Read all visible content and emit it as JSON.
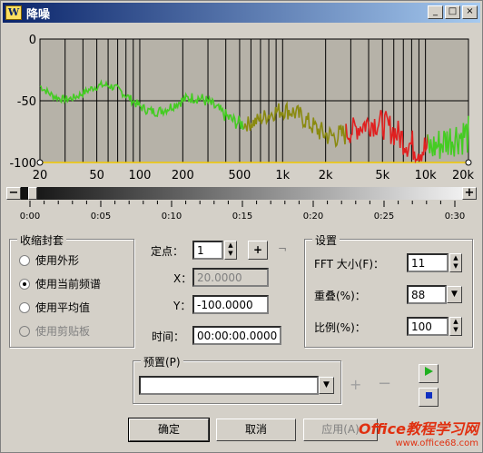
{
  "window": {
    "title": "降噪",
    "app_icon": "W"
  },
  "titlebar_buttons": {
    "minimize": "_",
    "maximize": "□",
    "close": "×"
  },
  "graph": {
    "y_ticks": [
      "0",
      "-50",
      "-100"
    ],
    "x_ticks": [
      "20",
      "50",
      "100",
      "200",
      "500",
      "1k",
      "2k",
      "5k",
      "10k",
      "20k"
    ],
    "colors": {
      "plot_bg": "#b6b2a8",
      "grid": "#000000",
      "low": "#44cc22",
      "high": "#e02020",
      "mid": "#8a8a10",
      "threshold": "#f0c800"
    }
  },
  "scroll": {
    "minus": "−",
    "plus": "+"
  },
  "ruler": {
    "labels": [
      "0:00",
      "0:05",
      "0:10",
      "0:15",
      "0:20",
      "0:25",
      "0:30"
    ]
  },
  "envelope": {
    "title": "收缩封套",
    "options": [
      {
        "label": "使用外形",
        "selected": false,
        "disabled": false
      },
      {
        "label": "使用当前频谱",
        "selected": true,
        "disabled": false
      },
      {
        "label": "使用平均值",
        "selected": false,
        "disabled": false
      },
      {
        "label": "使用剪贴板",
        "selected": false,
        "disabled": true
      }
    ]
  },
  "point": {
    "fixed_label": "定点：",
    "fixed_value": "1",
    "add_button": "+",
    "x_label": "X：",
    "x_value": "20.0000",
    "y_label": "Y：",
    "y_value": "-100.0000",
    "time_label": "时间：",
    "time_value": "00:00:00.0000"
  },
  "settings": {
    "title": "设置",
    "fft_label": "FFT 大小(F)：",
    "fft_value": "11",
    "overlap_label": "重叠(%)：",
    "overlap_value": "88",
    "ratio_label": "比例(%)：",
    "ratio_value": "100"
  },
  "preset": {
    "title": "预置(P)",
    "value": "",
    "add": "+",
    "remove": "−"
  },
  "buttons": {
    "ok": "确定",
    "cancel": "取消",
    "apply": "应用(A)"
  },
  "watermark": {
    "main": "Office教程学习网",
    "sub": "www.office68.com"
  }
}
